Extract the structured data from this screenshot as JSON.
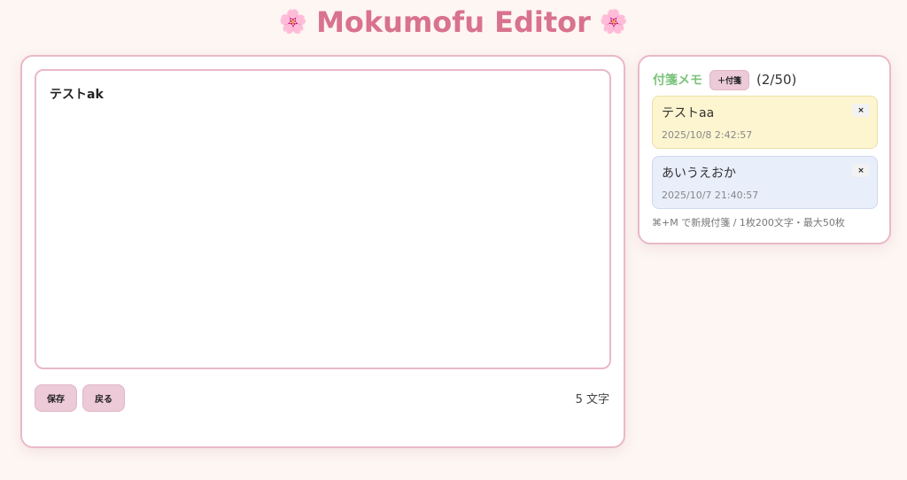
{
  "app": {
    "title": "Mokumofu Editor",
    "flower_glyph": "🌸"
  },
  "editor": {
    "text": "テストak",
    "save_label": "保存",
    "back_label": "戻る",
    "char_count": "5 文字"
  },
  "memo": {
    "title": "付箋メモ",
    "add_label": "＋付箋",
    "count": "(2/50)",
    "notes": [
      {
        "text": "テストaa",
        "date": "2025/10/8 2:42:57",
        "color": "yellow"
      },
      {
        "text": "あいうえおか",
        "date": "2025/10/7 21:40:57",
        "color": "blue"
      }
    ],
    "close_glyph": "×",
    "footer": "⌘+M で新規付箋 / 1枚200文字・最大50枚"
  },
  "colors": {
    "accent": "#d9728c",
    "memo_title": "#7cc37c",
    "button_bg": "#eccad8",
    "border": "#e9b9c8"
  }
}
